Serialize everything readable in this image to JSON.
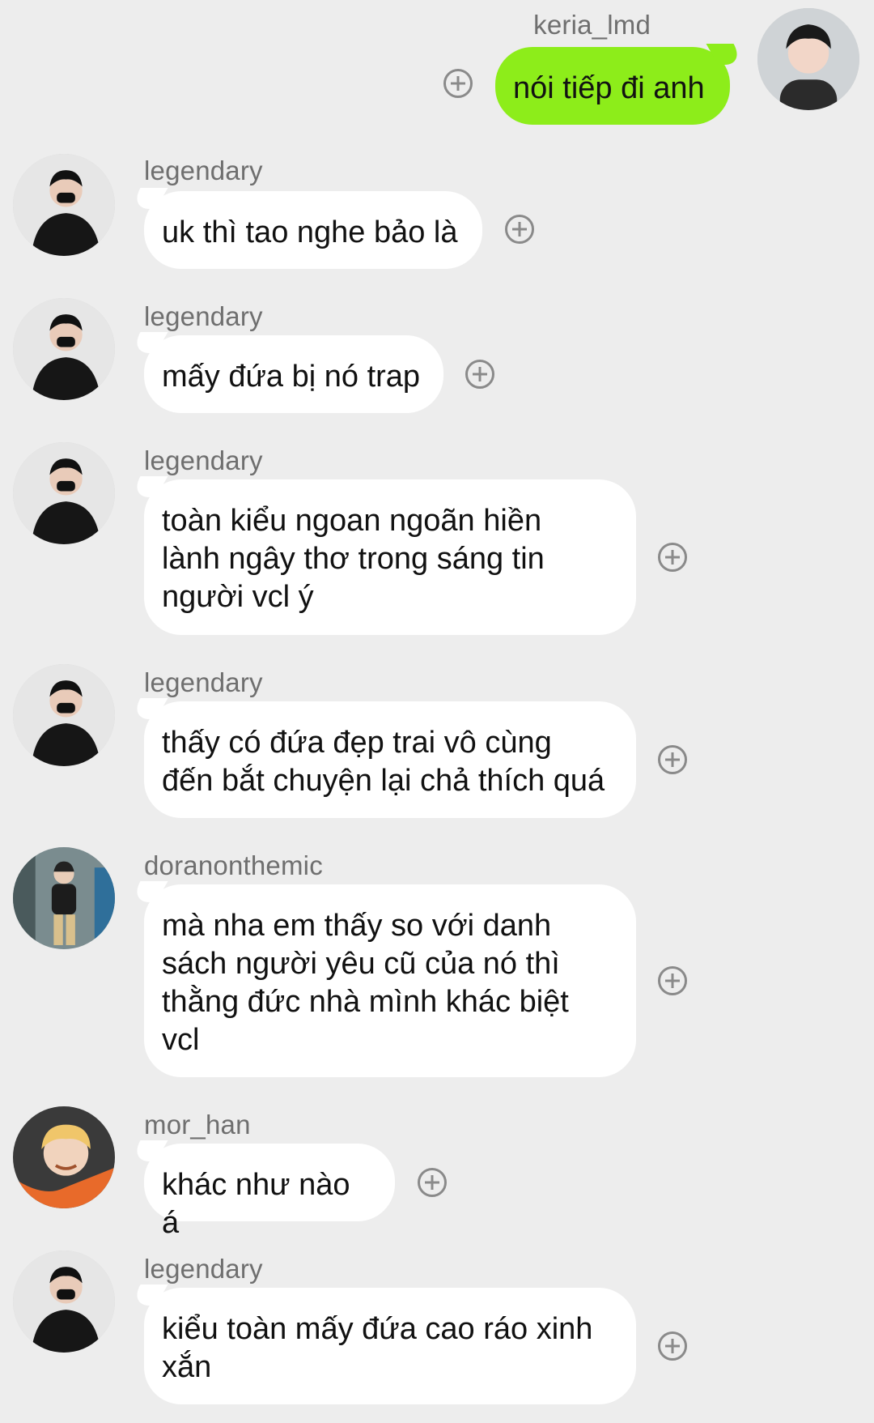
{
  "messages": [
    {
      "sender": "keria_lmd",
      "text": "nói tiếp đi anh",
      "mine": true,
      "avatar_icon": "avatar-keria"
    },
    {
      "sender": "legendary",
      "text": "uk thì tao nghe bảo là",
      "avatar_icon": "avatar-legendary"
    },
    {
      "sender": "legendary",
      "text": "mấy đứa bị nó trap",
      "avatar_icon": "avatar-legendary"
    },
    {
      "sender": "legendary",
      "lines": [
        "toàn kiểu ngoan ngoãn hiền",
        "lành ngây thơ trong sáng tin",
        "người vcl ý"
      ],
      "avatar_icon": "avatar-legendary"
    },
    {
      "sender": "legendary",
      "lines": [
        "thấy có đứa đẹp trai vô cùng",
        "đến bắt chuyện lại chả thích quá"
      ],
      "avatar_icon": "avatar-legendary"
    },
    {
      "sender": "doranonthemic",
      "lines": [
        "mà nha em thấy so với danh",
        "sách người yêu cũ của nó thì",
        "thằng đức nhà mình khác biệt",
        "vcl"
      ],
      "avatar_icon": "avatar-doran"
    },
    {
      "sender": "mor_han",
      "text": "khác như nào á",
      "avatar_icon": "avatar-morhan"
    },
    {
      "sender": "legendary",
      "lines": [
        "kiểu toàn mấy đứa cao ráo xinh",
        "xắn"
      ],
      "avatar_icon": "avatar-legendary"
    }
  ],
  "colors": {
    "background": "#ededed",
    "mine_bubble": "#8ded1a",
    "other_bubble": "#ffffff",
    "sender_text": "#6f6f6f",
    "icon": "#8a8a8a"
  },
  "icons": {
    "react": "plus-circle-icon"
  }
}
